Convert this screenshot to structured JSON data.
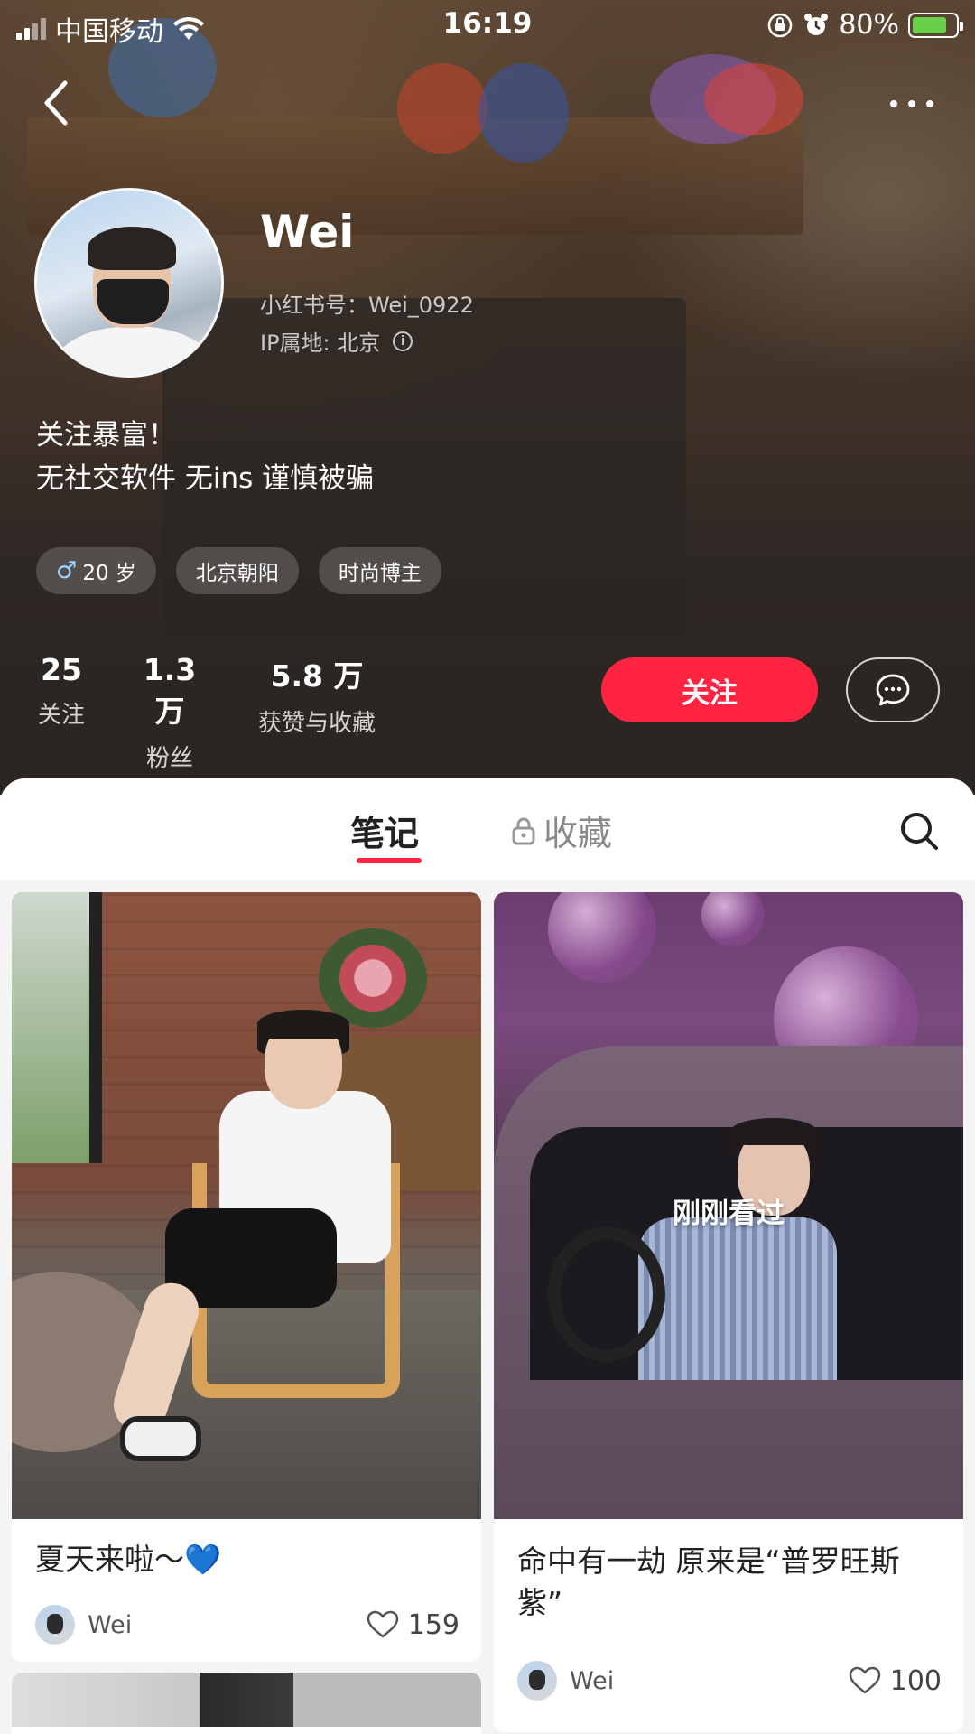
{
  "status_bar": {
    "carrier": "中国移动",
    "time": "16:19",
    "battery": "80%",
    "battery_level": 0.8
  },
  "profile": {
    "name": "Wei",
    "red_id": "小红书号：Wei_0922",
    "ip_location": "IP属地: 北京",
    "bio_line1": "关注暴富！",
    "bio_line2": "无社交软件 无ins 谨慎被骗",
    "tags": {
      "age": "20 岁",
      "location": "北京朝阳",
      "role": "时尚博主"
    },
    "stats": {
      "following_count": "25",
      "following_label": "关注",
      "followers_count": "1.3 万",
      "followers_label": "粉丝",
      "likes_count": "5.8 万",
      "likes_label": "获赞与收藏"
    },
    "follow_button": "关注"
  },
  "tabs": {
    "notes": "笔记",
    "favorites": "收藏"
  },
  "notes": [
    {
      "title": "夏天来啦～💙",
      "author": "Wei",
      "likes": "159"
    },
    {
      "title": "命中有一劫 原来是“普罗旺斯紫”",
      "author": "Wei",
      "likes": "100",
      "overlay": "刚刚看过"
    }
  ],
  "colors": {
    "accent": "#ff2442",
    "header_bg": "#2a2522"
  }
}
